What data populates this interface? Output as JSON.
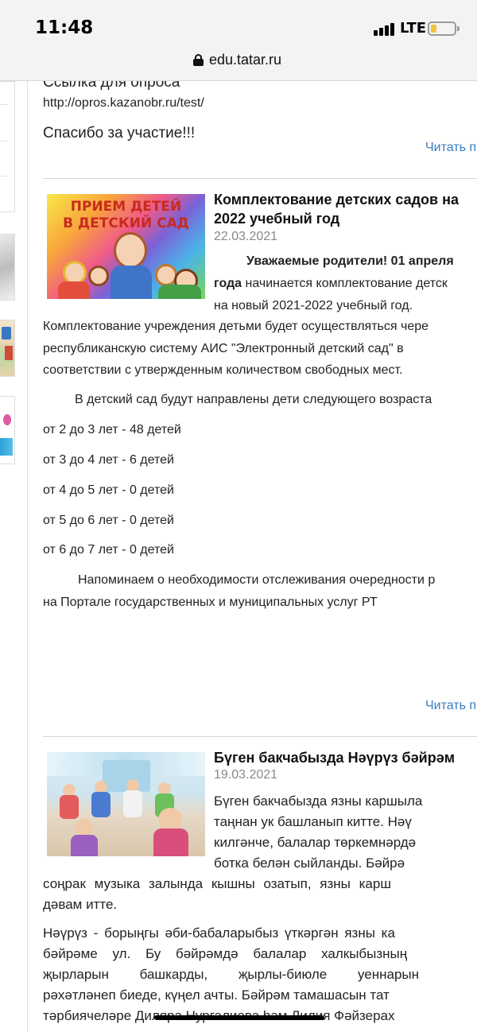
{
  "status": {
    "time": "11:48",
    "network": "LTE",
    "battery_color": "#f3c43a"
  },
  "browser": {
    "url": "edu.tatar.ru",
    "lock_icon": "lock-icon"
  },
  "colors": {
    "link": "#3a7bbf",
    "date": "#888888",
    "title_text": "#111111"
  },
  "post0": {
    "survey_label": "Ссылка для опроса",
    "survey_url": "http://opros.kazanobr.ru/test/",
    "thanks": "Спасибо за участие!!!",
    "read_more": "Читать п"
  },
  "post1": {
    "image_caption_line1": "ПРИЕМ ДЕТЕЙ",
    "image_caption_line2": "В ДЕТСКИЙ САД",
    "title_line1": "Комплектование детских садов на",
    "title_line2": "2022 учебный год",
    "date": "22.03.2021",
    "lead_bold_line1": "Уважаемые родители! 01 апреля",
    "lead_bold_line2": "года",
    "lead_rest_line2": " начинается комплектование детск",
    "lead_line3": "на новый 2021-2022 учебный год.",
    "body_line1": "Комплектование учреждения детьми будет осуществляться чере",
    "body_line2": "республиканскую систему АИС \"Электронный детский сад\" в",
    "body_line3": "соответствии с утвержденным количеством свободных мест.",
    "age_intro": "В детский сад будут направлены дети следующего возраста",
    "ages": [
      "от 2 до 3 лет - 48 детей",
      "от 3 до 4 лет - 6 детей",
      "от 4 до 5 лет - 0 детей",
      "от 5 до 6 лет - 0 детей",
      "от 6 до 7 лет - 0 детей"
    ],
    "reminder_line1": "Напоминаем о необходимости отслеживания очередности р",
    "reminder_line2": "на Портале государственных и муниципальных услуг РТ",
    "read_more": "Читать п"
  },
  "post2": {
    "title": "Бүген бакчабызда Нәүрүз бәйрәм",
    "date": "19.03.2021",
    "p1": [
      "Бүген бакчабызда язны каршыла",
      "таңнан ук башланып китте. Нәү",
      "килгәнче, балалар төркемнәрдә",
      "ботка белән сыйланды. Бәйрә",
      "соңрак музыка залында кышны озатып, язны карш",
      "дәвам итте."
    ],
    "p2": [
      "Нәүрүз - борыңгы әби-бабаларыбыз үткәргән язны ка",
      "бәйрәме ул. Бу бәйрәмдә балалар халкыбызның",
      "җырларын башкарды, җырлы-биюле уеннарын",
      "рәхәтләнеп биеде, күңел ачты. Бәйрәм тамашасын тат",
      "тәрбиячеләре Диляра Нургалиева һәм Лилия Фәйзерах"
    ]
  }
}
